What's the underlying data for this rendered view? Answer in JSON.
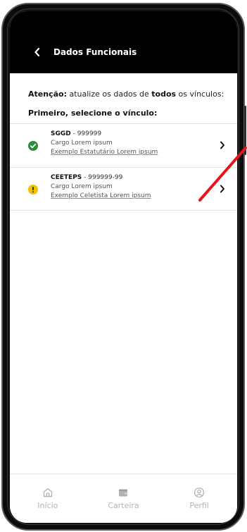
{
  "header": {
    "title": "Dados Funcionais"
  },
  "intro": {
    "prefix_bold": "Atenção:",
    "text_1": " atualize os dados de ",
    "emphasis_bold": "todos",
    "text_2": " os vínculos:",
    "subtitle": "Primeiro, selecione o vínculo:"
  },
  "vinculos": [
    {
      "org": "SGGD",
      "code": " - 999999",
      "cargo": "Cargo Lorem ipsum",
      "tipo": "Exemplo Estatutário Lorem ipsum",
      "status": "ok",
      "status_icon": "check-circle-icon",
      "status_color": "#2e8b3a"
    },
    {
      "org": "CEETEPS",
      "code": " - 999999-99",
      "cargo": "Cargo Lorem ipsum",
      "tipo": "Exemplo Celetista Lorem ipsum",
      "status": "warning",
      "status_icon": "warning-circle-icon",
      "status_color": "#f2c200"
    }
  ],
  "bottom_nav": {
    "items": [
      {
        "label": "Início",
        "icon": "home-icon"
      },
      {
        "label": "Carteira",
        "icon": "wallet-icon"
      },
      {
        "label": "Perfil",
        "icon": "profile-icon"
      }
    ]
  },
  "colors": {
    "header_bg": "#000000",
    "nav_inactive": "#b3b3b3",
    "annotation_arrow": "#e8141b"
  }
}
